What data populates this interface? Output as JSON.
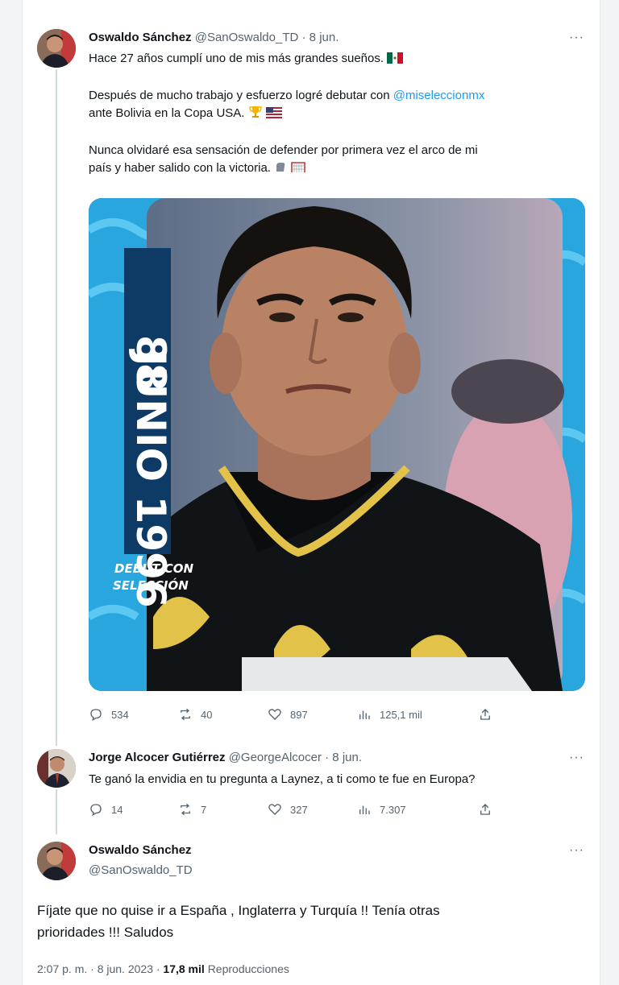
{
  "tweet1": {
    "display_name": "Oswaldo Sánchez",
    "handle": "@SanOswaldo_TD",
    "date": "· 8 jun.",
    "more": "···",
    "line1": "Hace 27 años cumplí uno de mis más grandes sueños.",
    "line2_a": "Después de mucho trabajo y esfuerzo logré debutar con ",
    "line2_mention": "@miseleccionmx",
    "line2_b": "ante Bolivia en la Copa USA.",
    "line3_a": "Nunca olvidaré esa sensación de defender por primera vez el arco de mi",
    "line3_b": "país y haber salido con la victoria.",
    "image": {
      "banner_text": "JUNIO 1996",
      "banner_top": "88",
      "caption_1": "DEBUT CON",
      "caption_2": "SELECCIÓN"
    },
    "stats": {
      "replies": "534",
      "retweets": "40",
      "likes": "897",
      "views": "125,1 mil"
    }
  },
  "tweet2": {
    "display_name": "Jorge Alcocer Gutiérrez",
    "handle": "@GeorgeAlcocer",
    "date": "· 8 jun.",
    "more": "···",
    "text": "Te ganó la envidia en tu pregunta a Laynez, a ti como te fue en Europa?",
    "stats": {
      "replies": "14",
      "retweets": "7",
      "likes": "327",
      "views": "7.307"
    }
  },
  "tweet3": {
    "display_name": "Oswaldo Sánchez",
    "handle": "@SanOswaldo_TD",
    "more": "···",
    "text_1": "Fíjate que no quise ir a España , Inglaterra y Turquía !! Tenía otras",
    "text_2": "prioridades !!! Saludos",
    "time": "2:07 p. m. · 8 jun. 2023 ·",
    "views_count": "17,8 mil",
    "views_label": "Reproducciones"
  },
  "colors": {
    "accent": "#1d9bf0",
    "muted": "#536471",
    "text": "#0f1419",
    "thread_line": "#cfd9de"
  }
}
